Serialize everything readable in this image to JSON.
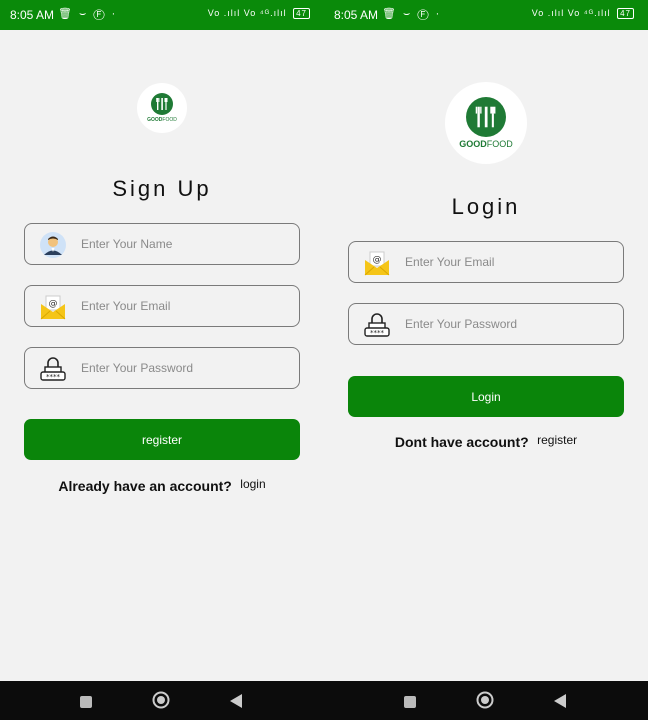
{
  "status_bar": {
    "time": "8:05 AM",
    "notification_icons": "🗑 ⌣ Ⓕ ·",
    "system_icons": "Vo .ılıl Vo ⁴ᴳ.ılıl",
    "battery": "47"
  },
  "brand": {
    "bold": "GOOD",
    "light": "FOOD"
  },
  "signup": {
    "title": "Sign Up",
    "name_placeholder": "Enter Your Name",
    "email_placeholder": "Enter Your Email",
    "password_placeholder": "Enter Your Password",
    "button_label": "register",
    "switch_question": "Already have an account?",
    "switch_link": "login"
  },
  "login": {
    "title": "Login",
    "email_placeholder": "Enter Your Email",
    "password_placeholder": "Enter Your Password",
    "button_label": "Login",
    "switch_question": "Dont have account?",
    "switch_link": "register"
  },
  "colors": {
    "status_bar": "#0a8a0a",
    "primary_button": "#0a850a",
    "brand_green": "#1f7a35",
    "background": "#f2f2f2",
    "nav_bar": "#0c0c0c"
  },
  "icons": {
    "name_field": "user-avatar-icon",
    "email_field": "email-envelope-icon",
    "password_field": "padlock-password-icon",
    "logo": "fork-knife-spatula-icon",
    "nav": [
      "recents-square-icon",
      "home-circle-icon",
      "back-triangle-icon"
    ]
  }
}
